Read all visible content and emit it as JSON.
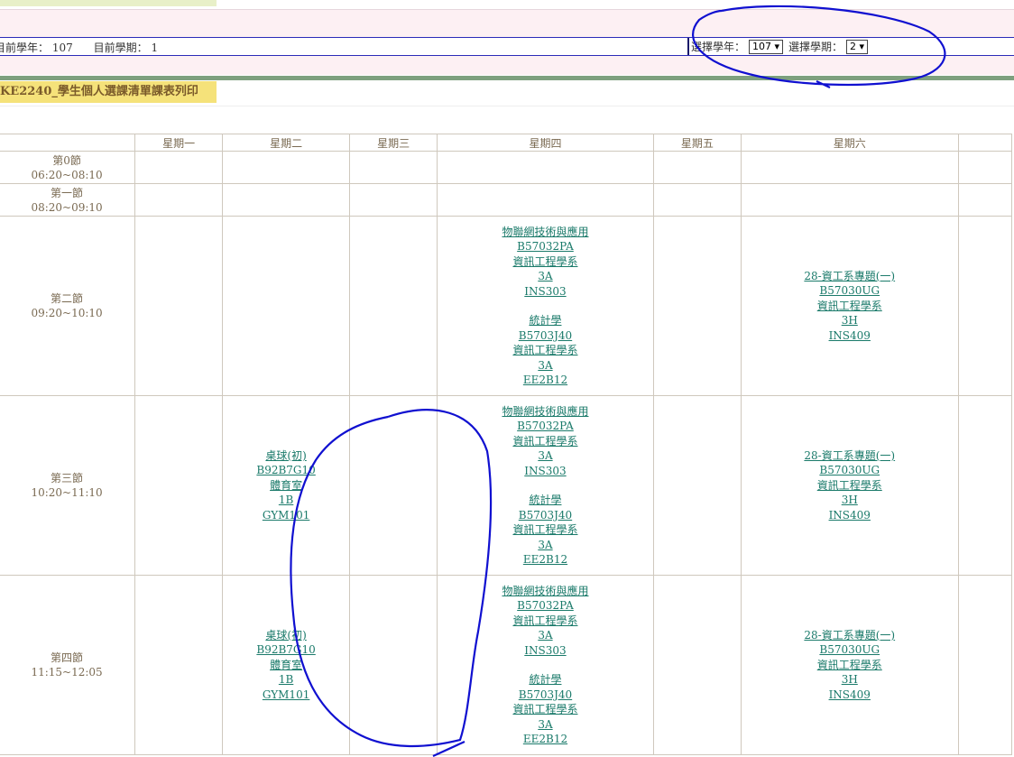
{
  "header": {
    "current_year_label": "目前學年：",
    "current_year": "107",
    "current_term_label": "目前學期：",
    "current_term": "1",
    "select_year_label": "選擇學年：",
    "select_year_value": "107 ▾",
    "select_term_label": "選擇學期：",
    "select_term_value": "2 ▾"
  },
  "page_title": "KE2240_學生個人選課清單課表列印",
  "days": [
    "星期一",
    "星期二",
    "星期三",
    "星期四",
    "星期五",
    "星期六"
  ],
  "periods": [
    {
      "name": "第0節",
      "time": "06:20~08:10"
    },
    {
      "name": "第一節",
      "time": "08:20~09:10"
    },
    {
      "name": "第二節",
      "time": "09:20~10:10"
    },
    {
      "name": "第三節",
      "time": "10:20~11:10"
    },
    {
      "name": "第四節",
      "time": "11:15~12:05"
    }
  ],
  "courses": {
    "iot": [
      "物聯網技術與應用",
      "B57032PA",
      "資訊工程學系",
      "3A",
      "INS303"
    ],
    "stat": [
      "統計學",
      "B5703J40",
      "資訊工程學系",
      "3A",
      "EE2B12"
    ],
    "project": [
      "28-資工系專題(一)",
      "B57030UG",
      "資訊工程學系",
      "3H",
      "INS409"
    ],
    "pingpong": [
      "桌球(初)",
      "B92B7G10",
      "體育室",
      "1B",
      "GYM101"
    ]
  },
  "annotation_color": "#1010d0"
}
